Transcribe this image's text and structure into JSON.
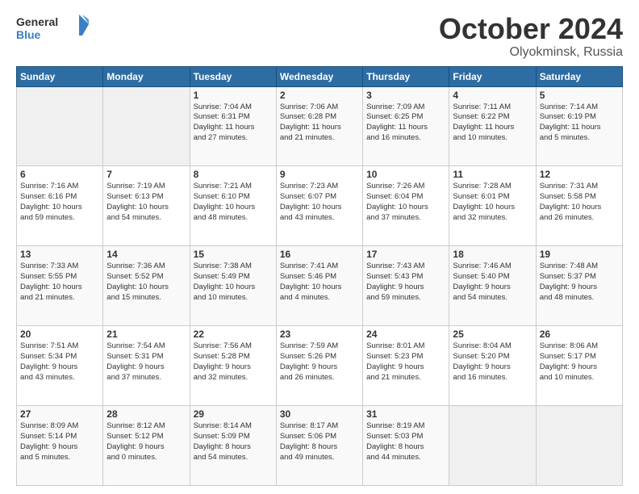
{
  "header": {
    "logo_general": "General",
    "logo_blue": "Blue",
    "month": "October 2024",
    "location": "Olyokminsk, Russia"
  },
  "days_of_week": [
    "Sunday",
    "Monday",
    "Tuesday",
    "Wednesday",
    "Thursday",
    "Friday",
    "Saturday"
  ],
  "weeks": [
    [
      {
        "day": "",
        "info": ""
      },
      {
        "day": "",
        "info": ""
      },
      {
        "day": "1",
        "info": "Sunrise: 7:04 AM\nSunset: 6:31 PM\nDaylight: 11 hours\nand 27 minutes."
      },
      {
        "day": "2",
        "info": "Sunrise: 7:06 AM\nSunset: 6:28 PM\nDaylight: 11 hours\nand 21 minutes."
      },
      {
        "day": "3",
        "info": "Sunrise: 7:09 AM\nSunset: 6:25 PM\nDaylight: 11 hours\nand 16 minutes."
      },
      {
        "day": "4",
        "info": "Sunrise: 7:11 AM\nSunset: 6:22 PM\nDaylight: 11 hours\nand 10 minutes."
      },
      {
        "day": "5",
        "info": "Sunrise: 7:14 AM\nSunset: 6:19 PM\nDaylight: 11 hours\nand 5 minutes."
      }
    ],
    [
      {
        "day": "6",
        "info": "Sunrise: 7:16 AM\nSunset: 6:16 PM\nDaylight: 10 hours\nand 59 minutes."
      },
      {
        "day": "7",
        "info": "Sunrise: 7:19 AM\nSunset: 6:13 PM\nDaylight: 10 hours\nand 54 minutes."
      },
      {
        "day": "8",
        "info": "Sunrise: 7:21 AM\nSunset: 6:10 PM\nDaylight: 10 hours\nand 48 minutes."
      },
      {
        "day": "9",
        "info": "Sunrise: 7:23 AM\nSunset: 6:07 PM\nDaylight: 10 hours\nand 43 minutes."
      },
      {
        "day": "10",
        "info": "Sunrise: 7:26 AM\nSunset: 6:04 PM\nDaylight: 10 hours\nand 37 minutes."
      },
      {
        "day": "11",
        "info": "Sunrise: 7:28 AM\nSunset: 6:01 PM\nDaylight: 10 hours\nand 32 minutes."
      },
      {
        "day": "12",
        "info": "Sunrise: 7:31 AM\nSunset: 5:58 PM\nDaylight: 10 hours\nand 26 minutes."
      }
    ],
    [
      {
        "day": "13",
        "info": "Sunrise: 7:33 AM\nSunset: 5:55 PM\nDaylight: 10 hours\nand 21 minutes."
      },
      {
        "day": "14",
        "info": "Sunrise: 7:36 AM\nSunset: 5:52 PM\nDaylight: 10 hours\nand 15 minutes."
      },
      {
        "day": "15",
        "info": "Sunrise: 7:38 AM\nSunset: 5:49 PM\nDaylight: 10 hours\nand 10 minutes."
      },
      {
        "day": "16",
        "info": "Sunrise: 7:41 AM\nSunset: 5:46 PM\nDaylight: 10 hours\nand 4 minutes."
      },
      {
        "day": "17",
        "info": "Sunrise: 7:43 AM\nSunset: 5:43 PM\nDaylight: 9 hours\nand 59 minutes."
      },
      {
        "day": "18",
        "info": "Sunrise: 7:46 AM\nSunset: 5:40 PM\nDaylight: 9 hours\nand 54 minutes."
      },
      {
        "day": "19",
        "info": "Sunrise: 7:48 AM\nSunset: 5:37 PM\nDaylight: 9 hours\nand 48 minutes."
      }
    ],
    [
      {
        "day": "20",
        "info": "Sunrise: 7:51 AM\nSunset: 5:34 PM\nDaylight: 9 hours\nand 43 minutes."
      },
      {
        "day": "21",
        "info": "Sunrise: 7:54 AM\nSunset: 5:31 PM\nDaylight: 9 hours\nand 37 minutes."
      },
      {
        "day": "22",
        "info": "Sunrise: 7:56 AM\nSunset: 5:28 PM\nDaylight: 9 hours\nand 32 minutes."
      },
      {
        "day": "23",
        "info": "Sunrise: 7:59 AM\nSunset: 5:26 PM\nDaylight: 9 hours\nand 26 minutes."
      },
      {
        "day": "24",
        "info": "Sunrise: 8:01 AM\nSunset: 5:23 PM\nDaylight: 9 hours\nand 21 minutes."
      },
      {
        "day": "25",
        "info": "Sunrise: 8:04 AM\nSunset: 5:20 PM\nDaylight: 9 hours\nand 16 minutes."
      },
      {
        "day": "26",
        "info": "Sunrise: 8:06 AM\nSunset: 5:17 PM\nDaylight: 9 hours\nand 10 minutes."
      }
    ],
    [
      {
        "day": "27",
        "info": "Sunrise: 8:09 AM\nSunset: 5:14 PM\nDaylight: 9 hours\nand 5 minutes."
      },
      {
        "day": "28",
        "info": "Sunrise: 8:12 AM\nSunset: 5:12 PM\nDaylight: 9 hours\nand 0 minutes."
      },
      {
        "day": "29",
        "info": "Sunrise: 8:14 AM\nSunset: 5:09 PM\nDaylight: 8 hours\nand 54 minutes."
      },
      {
        "day": "30",
        "info": "Sunrise: 8:17 AM\nSunset: 5:06 PM\nDaylight: 8 hours\nand 49 minutes."
      },
      {
        "day": "31",
        "info": "Sunrise: 8:19 AM\nSunset: 5:03 PM\nDaylight: 8 hours\nand 44 minutes."
      },
      {
        "day": "",
        "info": ""
      },
      {
        "day": "",
        "info": ""
      }
    ]
  ]
}
